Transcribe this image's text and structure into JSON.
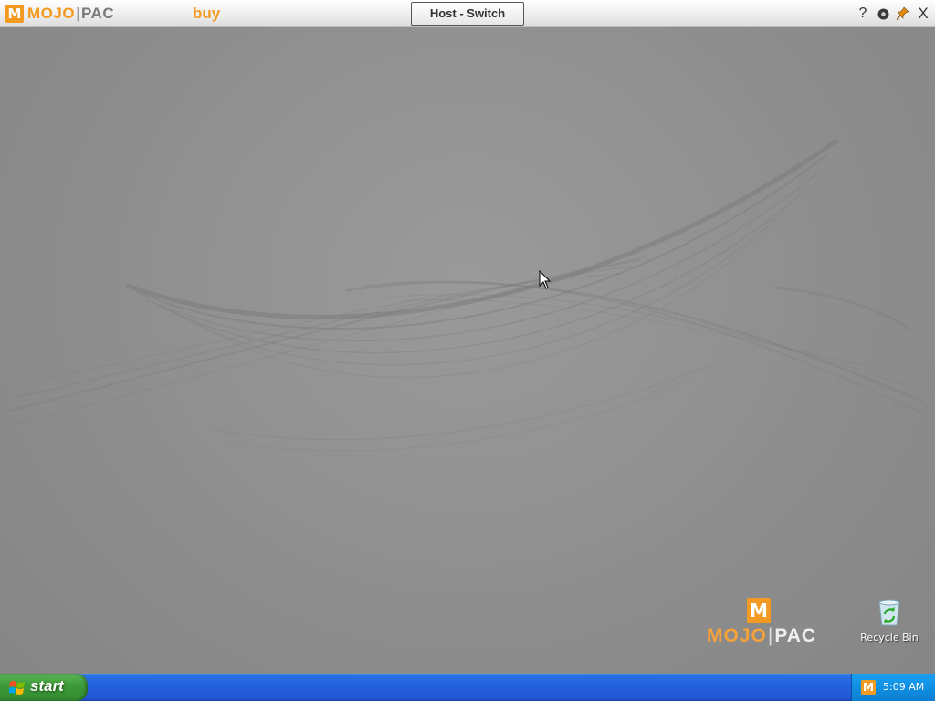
{
  "topbar": {
    "logo": {
      "mark": "M",
      "mojo": "MOJO",
      "pac": "PAC"
    },
    "buy_label": "buy",
    "host_switch_label": "Host - Switch",
    "icons": [
      {
        "name": "help-icon",
        "glyph": "?"
      },
      {
        "name": "settings-icon",
        "glyph": "●"
      },
      {
        "name": "pin-icon",
        "glyph": "📌"
      },
      {
        "name": "close-icon",
        "glyph": "X"
      }
    ]
  },
  "desktop": {
    "logo": {
      "mark": "M",
      "mojo": "MOJO",
      "pac": "PAC"
    },
    "icons": [
      {
        "name": "recycle-bin",
        "label": "Recycle Bin"
      }
    ]
  },
  "taskbar": {
    "start_label": "start",
    "tray": {
      "mark": "M",
      "clock": "5:09 AM"
    }
  },
  "colors": {
    "brand_orange": "#f29a21",
    "taskbar_blue": "#245fdc",
    "start_green": "#3e9c3a",
    "desktop_gray": "#8e8e8e"
  }
}
